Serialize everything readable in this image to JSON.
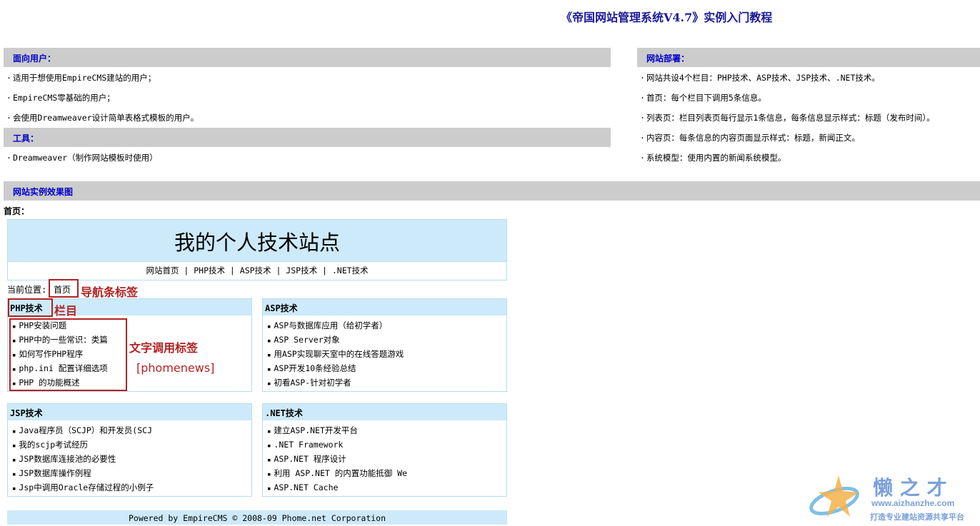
{
  "page_title": "《帝国网站管理系统V4.7》实例入门教程",
  "audience": {
    "title": "面向用户：",
    "items": [
      "适用于想使用EmpireCMS建站的用户；",
      "EmpireCMS零基础的用户；",
      "会使用Dreamweaver设计简单表格式模板的用户。"
    ]
  },
  "tools": {
    "title": "工具：",
    "items": [
      "Dreamweaver（制作网站模板时使用）"
    ]
  },
  "deploy": {
    "title": "网站部署：",
    "items": [
      "网站共设4个栏目：PHP技术、ASP技术、JSP技术、.NET技术。",
      "首页：每个栏目下调用5条信息。",
      "列表页：栏目列表页每行显示1条信息，每条信息显示样式：标题（发布时间）。",
      "内容页：每条信息的内容页面显示样式：标题，新闻正文。",
      "系统模型：使用内置的新闻系统模型。"
    ]
  },
  "example": {
    "title": "网站实例效果图",
    "home_label": "首页："
  },
  "site": {
    "title": "我的个人技术站点",
    "nav": "网站首页 | PHP技术 | ASP技术 | JSP技术 | .NET技术",
    "crumb_prefix": "当前位置:",
    "crumb_home": "首页",
    "footer": "Powered by EmpireCMS © 2008-09 Phome.net Corporation"
  },
  "annotations": {
    "nav_tag": "导航条标签",
    "column": "栏目",
    "text_tag": "文字调用标签",
    "tag_name": "[phomenews]"
  },
  "panels": [
    {
      "title": "PHP技术",
      "items": [
        "PHP安装问题",
        "PHP中的一些常识：类篇",
        "如何写作PHP程序",
        "php.ini 配置详细选项",
        "PHP 的功能概述"
      ]
    },
    {
      "title": "ASP技术",
      "items": [
        "ASP与数据库应用（给初学者）",
        "ASP Server对象",
        "用ASP实现聊天室中的在线答题游戏",
        "ASP开发10条经验总结",
        "初看ASP-针对初学者"
      ]
    },
    {
      "title": "JSP技术",
      "items": [
        "Java程序员（SCJP）和开发员(SCJ",
        "我的scjp考试经历",
        "JSP数据库连接池的必要性",
        "JSP数据库操作例程",
        "Jsp中调用Oracle存储过程的小例子"
      ]
    },
    {
      "title": ".NET技术",
      "items": [
        "建立ASP.NET开发平台",
        ".NET Framework",
        "ASP.NET 程序设计",
        "利用 ASP.NET 的内置功能抵御 We",
        "ASP.NET Cache"
      ]
    }
  ],
  "watermark": {
    "name": "懒 之 才",
    "url": "www.aizhanzhe.com",
    "slogan": "打造专业建站资源共享平台"
  }
}
